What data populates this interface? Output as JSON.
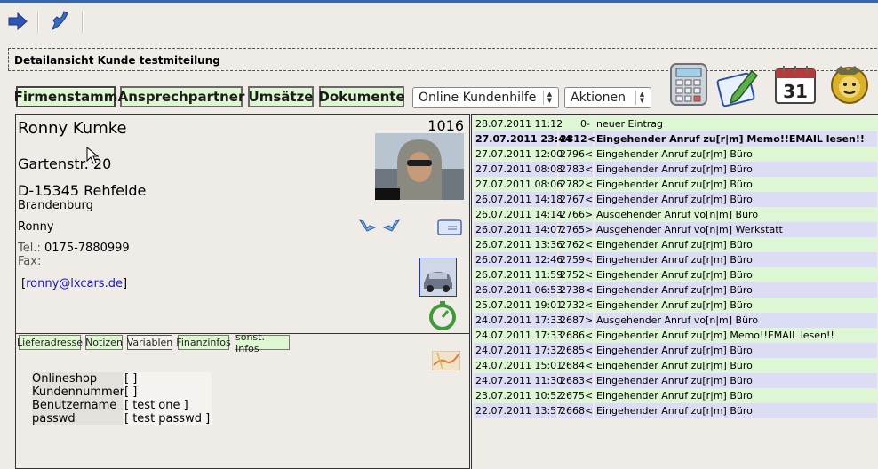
{
  "colors": {
    "row_green": "#ddf6d4",
    "row_blue": "#dcdcf5",
    "tab_bg": "#dff6d3",
    "title_bar": "#3a66b0"
  },
  "toolbar": {
    "icons": [
      "arrow-right-icon",
      "phone-icon"
    ]
  },
  "page": {
    "title": "Detailansicht Kunde testmiteilung"
  },
  "tabs": [
    {
      "label": "Firmenstamm",
      "active": true
    },
    {
      "label": "Ansprechpartner"
    },
    {
      "label": "Umsätze"
    },
    {
      "label": "Dokumente"
    }
  ],
  "selects": {
    "help": "Online Kundenhilfe",
    "actions": "Aktionen"
  },
  "app_icons": [
    "calculator-icon",
    "notepad-icon",
    "calendar-icon",
    "lion-mascot-icon"
  ],
  "calendar_day": "31",
  "customer": {
    "name": "Ronny Kumke",
    "number": "1016",
    "street": "Gartenstr. 20",
    "city": "D-15345 Rehfelde",
    "state": "Brandenburg",
    "first_name": "Ronny",
    "tel_label": "Tel.:",
    "tel": "0175-7880999",
    "fax_label": "Fax:",
    "email_open": "[",
    "email": "ronny@lxcars.de",
    "email_close": "]"
  },
  "subtabs": [
    {
      "label": "Lieferadresse"
    },
    {
      "label": "Notizen"
    },
    {
      "label": "Variablen",
      "active": true
    },
    {
      "label": "Finanzinfos"
    },
    {
      "label": "sonst. Infos"
    }
  ],
  "variables": [
    {
      "key": "Onlineshop",
      "value": "[ ]"
    },
    {
      "key": "Kundennummer",
      "value": "[ ]"
    },
    {
      "key": "Benutzername",
      "value": "[ test one ]"
    },
    {
      "key": "passwd",
      "value": "[ test passwd ]"
    }
  ],
  "history": [
    {
      "date": "28.07.2011 11:12",
      "num": "0-",
      "text": "neuer Eintrag",
      "color": "green",
      "bold": false
    },
    {
      "date": "27.07.2011 23:44",
      "num": "2812<",
      "text": "Eingehender Anruf zu[r|m] Memo!!EMAIL lesen!!",
      "color": "blue",
      "bold": true
    },
    {
      "date": "27.07.2011 12:00",
      "num": "2796<",
      "text": "Eingehender Anruf zu[r|m] Büro",
      "color": "green",
      "bold": false
    },
    {
      "date": "27.07.2011 08:08",
      "num": "2783<",
      "text": "Eingehender Anruf zu[r|m] Büro",
      "color": "blue",
      "bold": false
    },
    {
      "date": "27.07.2011 08:06",
      "num": "2782<",
      "text": "Eingehender Anruf zu[r|m] Büro",
      "color": "green",
      "bold": false
    },
    {
      "date": "26.07.2011 14:18",
      "num": "2767<",
      "text": "Eingehender Anruf zu[r|m] Büro",
      "color": "blue",
      "bold": false
    },
    {
      "date": "26.07.2011 14:14",
      "num": "2766>",
      "text": "Ausgehender Anruf vo[n|m] Büro",
      "color": "green",
      "bold": false
    },
    {
      "date": "26.07.2011 14:07",
      "num": "2765>",
      "text": "Ausgehender Anruf vo[n|m] Werkstatt",
      "color": "blue",
      "bold": false
    },
    {
      "date": "26.07.2011 13:36",
      "num": "2762<",
      "text": "Eingehender Anruf zu[r|m] Büro",
      "color": "green",
      "bold": false
    },
    {
      "date": "26.07.2011 12:46",
      "num": "2759<",
      "text": "Eingehender Anruf zu[r|m] Büro",
      "color": "blue",
      "bold": false
    },
    {
      "date": "26.07.2011 11:59",
      "num": "2752<",
      "text": "Eingehender Anruf zu[r|m] Büro",
      "color": "green",
      "bold": false
    },
    {
      "date": "26.07.2011 06:53",
      "num": "2738<",
      "text": "Eingehender Anruf zu[r|m] Büro",
      "color": "blue",
      "bold": false
    },
    {
      "date": "25.07.2011 19:01",
      "num": "2732<",
      "text": "Eingehender Anruf zu[r|m] Büro",
      "color": "green",
      "bold": false
    },
    {
      "date": "24.07.2011 17:33",
      "num": "2687>",
      "text": "Ausgehender Anruf vo[n|m] Büro",
      "color": "blue",
      "bold": false
    },
    {
      "date": "24.07.2011 17:33",
      "num": "2686<",
      "text": "Eingehender Anruf zu[r|m] Memo!!EMAIL lesen!!",
      "color": "green",
      "bold": false
    },
    {
      "date": "24.07.2011 17:32",
      "num": "2685<",
      "text": "Eingehender Anruf zu[r|m] Büro",
      "color": "blue",
      "bold": false
    },
    {
      "date": "24.07.2011 15:01",
      "num": "2684<",
      "text": "Eingehender Anruf zu[r|m] Büro",
      "color": "green",
      "bold": false
    },
    {
      "date": "24.07.2011 11:30",
      "num": "2683<",
      "text": "Eingehender Anruf zu[r|m] Büro",
      "color": "blue",
      "bold": false
    },
    {
      "date": "23.07.2011 10:52",
      "num": "2675<",
      "text": "Eingehender Anruf zu[r|m] Büro",
      "color": "green",
      "bold": false
    },
    {
      "date": "22.07.2011 13:57",
      "num": "2668<",
      "text": "Eingehender Anruf zu[r|m] Büro",
      "color": "blue",
      "bold": false
    }
  ]
}
